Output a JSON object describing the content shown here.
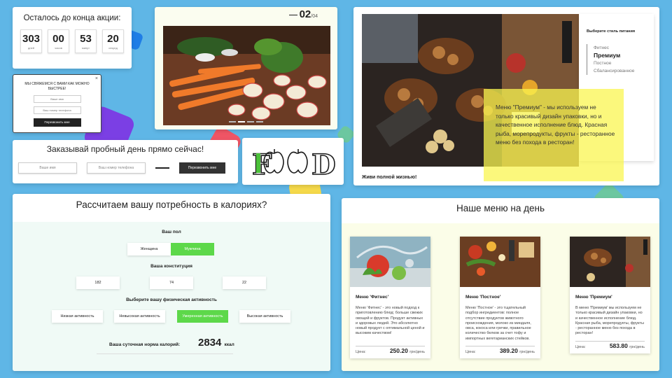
{
  "colors": {
    "background": "#5fb6e6",
    "accent_green": "#5dd84a",
    "highlight_yellow": "#faf550",
    "shape_blue": "#1f7de6",
    "shape_purple": "#7b3fe4",
    "shape_red": "#ef5565",
    "shape_teal": "#6cc7a0",
    "shape_yellow": "#f5d94a"
  },
  "countdown": {
    "title": "Осталось до конца акции:",
    "units": [
      {
        "value": "303",
        "label": "дней"
      },
      {
        "value": "00",
        "label": "часов"
      },
      {
        "value": "53",
        "label": "минут"
      },
      {
        "value": "20",
        "label": "секунд"
      }
    ]
  },
  "callback": {
    "title": "МЫ СВЯЖЕМСЯ С ВАМИ КАК МОЖНО БЫСТРЕЕ!",
    "name_placeholder": "Ваше имя",
    "phone_placeholder": "Ваш номер телефона",
    "button": "Перезвонить мне",
    "close": "×"
  },
  "trial": {
    "title": "Заказывай пробный день прямо сейчас!",
    "name_placeholder": "Ваше имя",
    "phone_placeholder": "Ваш номер телефона",
    "button": "Перезвонить мне"
  },
  "slider": {
    "current": "02",
    "total": "/04",
    "active_slide": 2,
    "slide_count": 4
  },
  "logo": {
    "text": "FOOD"
  },
  "premium": {
    "heading": "Выберите стиль питания",
    "styles": [
      "Фитнес",
      "Премиум",
      "Постное",
      "Сбалансированное"
    ],
    "active_style": "Премиум",
    "description": "Меню \"Премиум\" - мы используем не только красивый дизайн упаковки, но и качественное исполнение блюд. Красная рыба, морепродукты, фрукты - ресторанное меню без похода в ресторан!",
    "caption": "Живи полной жизнью!"
  },
  "calories": {
    "title": "Рассчитаем вашу потребность в калориях?",
    "gender_label": "Ваш пол",
    "gender_options": [
      "Женщина",
      "Мужчина"
    ],
    "gender_selected": "Мужчина",
    "build_label": "Ваша конституция",
    "build_values": [
      "182",
      "74",
      "22"
    ],
    "activity_label": "Выберите вашу физическая активность",
    "activity_options": [
      "Низкая активность",
      "Невысокая активность",
      "Умеренная активность",
      "Высокая активность"
    ],
    "activity_selected": "Умеренная активность",
    "result_label": "Ваша суточная норма калорий:",
    "result_value": "2834",
    "result_unit": "ккал"
  },
  "menu": {
    "title": "Наше меню на день",
    "price_label": "Цена:",
    "currency": "грн/день",
    "items": [
      {
        "name": "Меню 'Фитнес'",
        "description": "Меню 'Фитнес' - это новый подход к приготовлению блюд: больше свежих овощей и фруктов. Продукт активных и здоровых людей. Это абсолютно новый продукт с оптимальной ценой и высоким качеством!",
        "price": "250.20"
      },
      {
        "name": "Меню 'Постное'",
        "description": "Меню 'Постное' - это тщательный подбор ингредиентов: полное отсутствие продуктов животного происхождения, молоко из миндаля, овса, кокоса или гречки, правильное количество белков за счет тофу и импортных вегетарианских стейков.",
        "price": "389.20"
      },
      {
        "name": "Меню 'Премиум'",
        "description": "В меню 'Премиум' мы используем не только красивый дизайн упаковки, но и качественное исполнение блюд. Красная рыба, морепродукты, фрукты - ресторанное меню без похода в ресторан!",
        "price": "583.80"
      }
    ]
  }
}
